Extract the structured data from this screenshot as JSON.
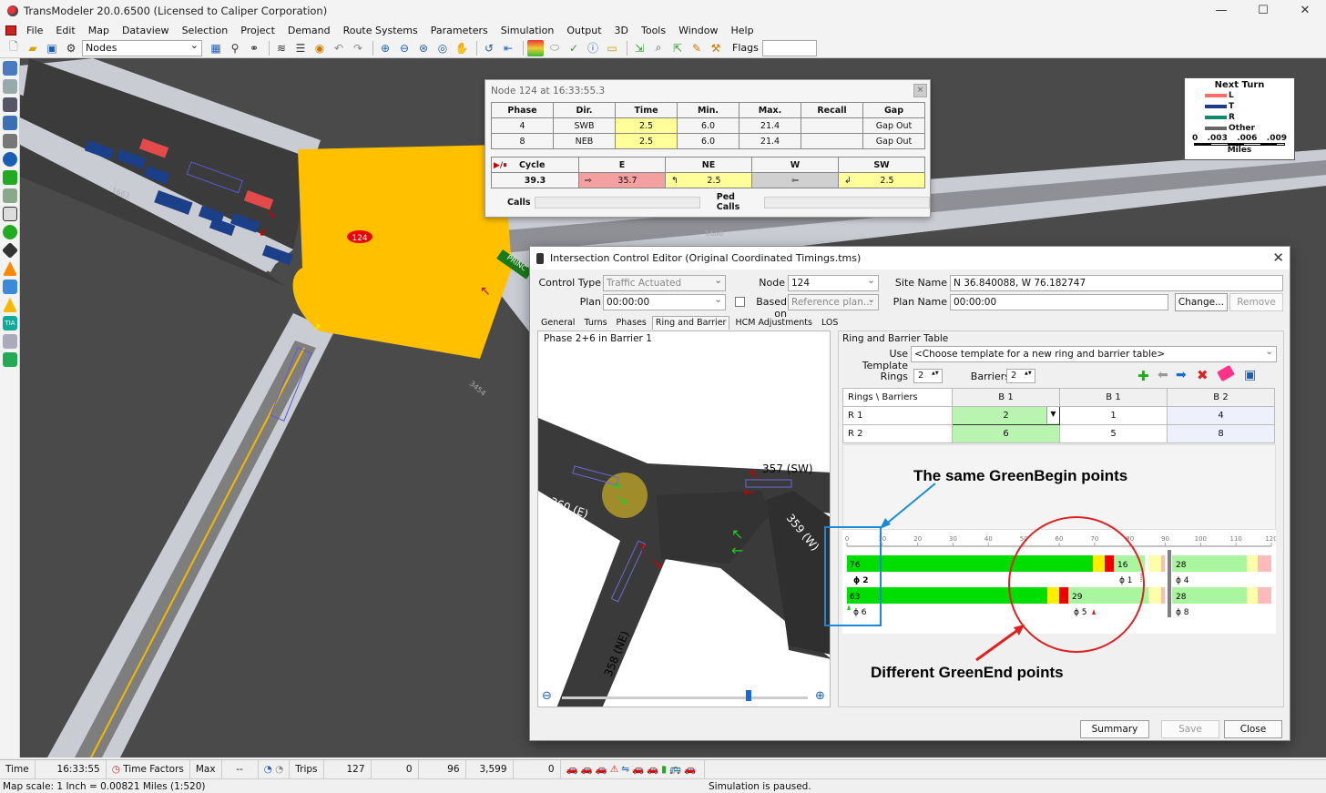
{
  "window": {
    "title": "TransModeler 20.0.6500 (Licensed to Caliper Corporation)",
    "minimize": "—",
    "maximize": "☐",
    "close": "✕"
  },
  "menu": [
    "File",
    "Edit",
    "Map",
    "Dataview",
    "Selection",
    "Project",
    "Demand",
    "Route Systems",
    "Parameters",
    "Simulation",
    "Output",
    "3D",
    "Tools",
    "Window",
    "Help"
  ],
  "toolbar": {
    "layer_value": "Nodes",
    "flags_label": "Flags",
    "flags_value": ""
  },
  "map": {
    "node_label": "124",
    "link_labels": [
      "1663",
      "1660",
      "3454"
    ],
    "street_label": "PRINC"
  },
  "node_panel": {
    "title": "Node 124 at 16:33:55.3",
    "close": "×",
    "headers": [
      "Phase",
      "Dir.",
      "Time",
      "Min.",
      "Max.",
      "Recall",
      "Gap"
    ],
    "rows": [
      [
        "4",
        "SWB",
        "2.5",
        "6.0",
        "21.4",
        "",
        "Gap Out"
      ],
      [
        "8",
        "NEB",
        "2.5",
        "6.0",
        "21.4",
        "",
        "Gap Out"
      ]
    ],
    "cycle_header": "Cycle",
    "dir_headers": [
      "E",
      "NE",
      "W",
      "SW"
    ],
    "cycle_value": "39.3",
    "dir_values": [
      "35.7",
      "2.5",
      "",
      "2.5"
    ],
    "dir_arrows": [
      "⇨",
      "↰",
      "⇦",
      "↲"
    ],
    "calls_label": "Calls",
    "ped_calls_label": "Ped Calls"
  },
  "legend": {
    "title": "Next Turn",
    "items": [
      {
        "label": "L",
        "color": "#ff6b6b"
      },
      {
        "label": "T",
        "color": "#1f3a8a"
      },
      {
        "label": "R",
        "color": "#0c8b6b"
      },
      {
        "label": "Other",
        "color": "#666666"
      }
    ],
    "scale_labels": [
      "0",
      ".003",
      ".006",
      ".009"
    ],
    "unit": "Miles"
  },
  "dialog": {
    "title": "Intersection Control Editor (Original Coordinated Timings.tms)",
    "close": "✕",
    "control_type_label": "Control Type",
    "control_type_value": "Traffic Actuated",
    "node_label": "Node",
    "node_value": "124",
    "site_name_label": "Site Name",
    "site_name_value": "N 36.840088, W 76.182747",
    "plan_label": "Plan",
    "plan_value": "00:00:00",
    "based_on_label": "Based on",
    "based_on_value": "Reference plan...",
    "plan_name_label": "Plan Name",
    "plan_name_value": "00:00:00",
    "change_button": "Change...",
    "remove_button": "Remove",
    "tabs": [
      "General",
      "Turns",
      "Phases",
      "Ring and Barrier",
      "HCM Adjustments",
      "LOS"
    ],
    "phase_view_title": "Phase 2+6 in Barrier 1",
    "approach_labels": [
      "357 (SW)",
      "360 (E)",
      "359 (W)",
      "358 (NE)"
    ],
    "rb_title": "Ring and Barrier Table",
    "use_template_label": "Use Template",
    "use_template_value": "<Choose template for a new ring and barrier table>",
    "rings_label": "Rings",
    "rings_value": "2",
    "barriers_label": "Barriers",
    "barriers_value": "2",
    "rb_headers": [
      "Rings \\ Barriers",
      "B 1",
      "B 1",
      "B 2"
    ],
    "rb_rows": [
      [
        "R 1",
        "2",
        "1",
        "4"
      ],
      [
        "R 2",
        "6",
        "5",
        "8"
      ]
    ],
    "timeline_ticks": [
      "0",
      "10",
      "20",
      "30",
      "40",
      "50",
      "60",
      "70",
      "80",
      "90",
      "100",
      "110",
      "120"
    ],
    "ring1_values": [
      "76",
      "16",
      "28"
    ],
    "ring2_values": [
      "63",
      "29",
      "28"
    ],
    "ring1_phases": [
      "ϕ 2",
      "ϕ 1",
      "ϕ 4"
    ],
    "ring2_phases": [
      "ϕ 6",
      "ϕ 5",
      "ϕ 8"
    ],
    "annotation_top": "The same GreenBegin points",
    "annotation_bottom": "Different GreenEnd points",
    "summary_button": "Summary",
    "save_button": "Save",
    "close_button": "Close"
  },
  "status": {
    "time_label": "Time",
    "time_value": "16:33:55",
    "time_factors_label": "Time Factors",
    "max_label": "Max",
    "max_value": "--",
    "trips_label": "Trips",
    "trips_value": "127",
    "counts": [
      "0",
      "96",
      "3,599",
      "0"
    ],
    "map_scale": "Map scale: 1 Inch = 0.00821 Miles (1:520)",
    "sim_status": "Simulation is paused."
  }
}
